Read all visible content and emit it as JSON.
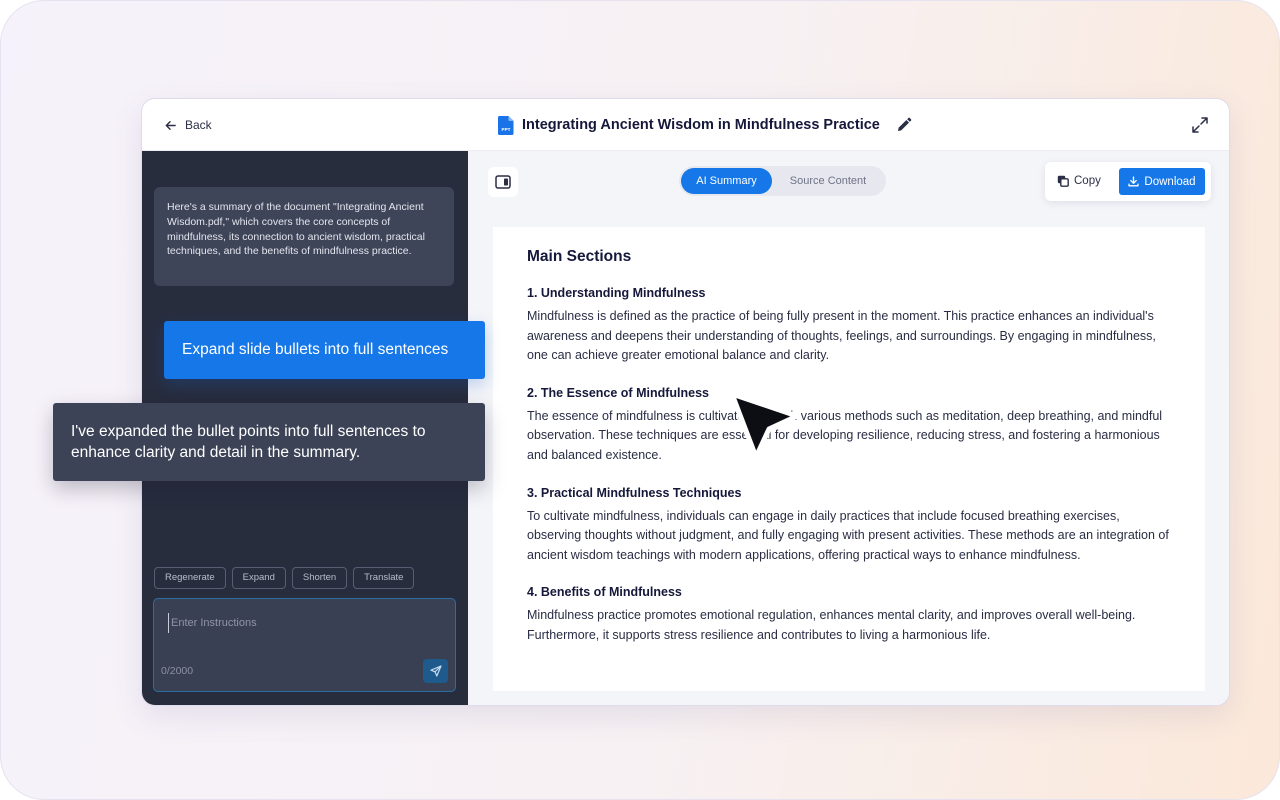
{
  "header": {
    "back_label": "Back",
    "file_badge": "PPT",
    "title": "Integrating Ancient Wisdom in Mindfulness Practice"
  },
  "chat": {
    "ai_message": "Here's a summary of the document \"Integrating Ancient Wisdom.pdf,\" which covers the core concepts of mindfulness, its connection to ancient wisdom, practical techniques, and the benefits of mindfulness practice.",
    "user_message": "Expand slide bullets into full sentences",
    "ai_reply": "I've expanded the bullet points into full sentences to enhance clarity and detail in the summary.",
    "chips": [
      "Regenerate",
      "Expand",
      "Shorten",
      "Translate"
    ],
    "input_placeholder": "Enter Instructions",
    "char_count": "0/2000"
  },
  "tabs": {
    "active": "AI Summary",
    "inactive": "Source Content"
  },
  "actions": {
    "copy_label": "Copy",
    "download_label": "Download"
  },
  "summary": {
    "heading": "Main Sections",
    "sections": [
      {
        "title": "1. Understanding Mindfulness",
        "body": "Mindfulness is defined as the practice of being fully present in the moment. This practice enhances an individual's awareness and deepens their understanding of thoughts, feelings, and surroundings. By engaging in mindfulness, one can achieve greater emotional balance and clarity."
      },
      {
        "title": "2. The Essence of Mindfulness",
        "body": "The essence of mindfulness is cultivated through various methods such as meditation, deep breathing, and mindful observation. These techniques are essential for developing resilience, reducing stress, and fostering a harmonious and balanced existence."
      },
      {
        "title": "3. Practical Mindfulness Techniques",
        "body": "To cultivate mindfulness, individuals can engage in daily practices that include focused breathing exercises, observing thoughts without judgment, and fully engaging with present activities. These methods are an integration of ancient wisdom teachings with modern applications, offering practical ways to enhance mindfulness."
      },
      {
        "title": "4. Benefits of Mindfulness",
        "body": "Mindfulness practice promotes emotional regulation, enhances mental clarity, and improves overall well-being. Furthermore, it supports stress resilience and contributes to living a harmonious life."
      }
    ]
  },
  "colors": {
    "accent": "#1577e8",
    "sidebar_bg": "#282d3e",
    "bubble_bg": "#3f4558",
    "text_dark": "#15183a"
  },
  "icons": {
    "back": "arrow-left-icon",
    "file": "ppt-file-icon",
    "edit": "pencil-icon",
    "expand": "expand-arrows-icon",
    "panel": "panel-toggle-icon",
    "copy": "copy-icon",
    "download": "download-icon",
    "send": "paper-plane-icon",
    "cursor": "mouse-pointer-icon"
  }
}
